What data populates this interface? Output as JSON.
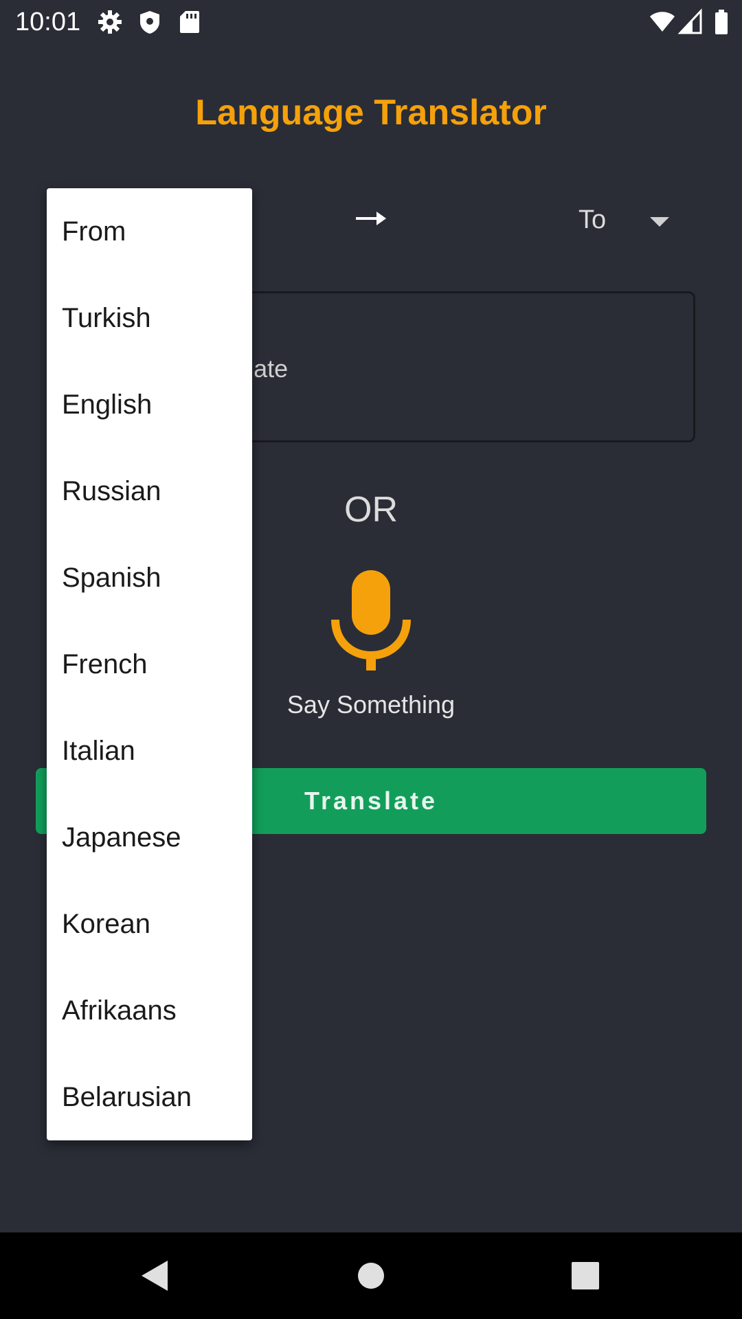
{
  "status_bar": {
    "time": "10:01",
    "left_icons": [
      "settings-icon",
      "shield-icon",
      "sd-card-icon"
    ],
    "right_icons": [
      "wifi-icon",
      "signal-icon",
      "battery-icon"
    ]
  },
  "app": {
    "title": "Language Translator",
    "accent_color": "#f5a10b",
    "background_color": "#2a2d36"
  },
  "language_row": {
    "from_label": "From",
    "arrow_icon": "arrow-right-icon",
    "to_label": "To",
    "to_caret_icon": "caret-down-icon"
  },
  "input": {
    "placeholder": "Enter your text to translate",
    "visible_text": "ur text to translate"
  },
  "voice": {
    "or_label": "OR",
    "mic_icon": "microphone-icon",
    "label": "Say Something"
  },
  "translate_button": {
    "label": "Translate",
    "color": "#129e5a"
  },
  "dropdown": {
    "items": [
      "From",
      "Turkish",
      "English",
      "Russian",
      "Spanish",
      "French",
      "Italian",
      "Japanese",
      "Korean",
      "Afrikaans",
      "Belarusian"
    ]
  },
  "nav_bar": {
    "buttons": [
      "back-icon",
      "home-icon",
      "recents-icon"
    ]
  }
}
